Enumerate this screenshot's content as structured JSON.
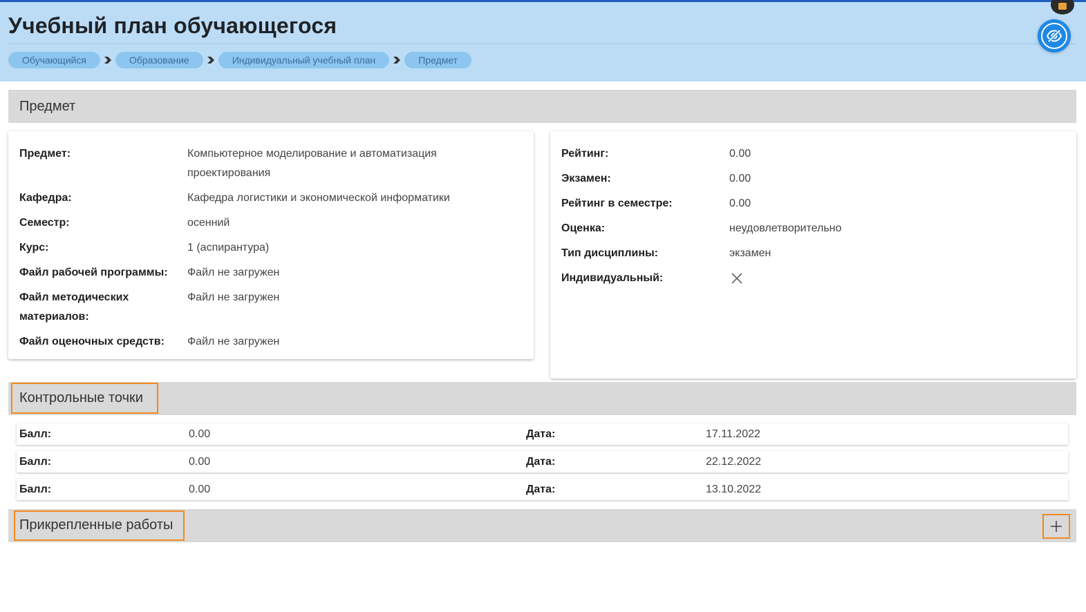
{
  "header": {
    "title": "Учебный план обучающегося",
    "breadcrumbs": [
      "Обучающийся",
      "Образование",
      "Индивидуальный учебный план",
      "Предмет"
    ],
    "hide_icon": "eye-off-icon",
    "chat_icon": "chat-icon"
  },
  "subject_section": {
    "title": "Предмет",
    "left": [
      {
        "label": "Предмет:",
        "value_line1": "Компьютерное моделирование и автоматизация",
        "value_line2": "проектирования"
      },
      {
        "label": "Кафедра:",
        "value": "Кафедра логистики и экономической информатики"
      },
      {
        "label": "Семестр:",
        "value": "осенний"
      },
      {
        "label": "Курс:",
        "value": "1 (аспирантура)"
      },
      {
        "label": "Файл рабочей программы:",
        "value": "Файл не загружен"
      },
      {
        "label_line1": "Файл методических",
        "label_line2": "материалов:",
        "value": "Файл не загружен"
      },
      {
        "label": "Файл оценочных средств:",
        "value": "Файл не загружен"
      }
    ],
    "right": [
      {
        "label": "Рейтинг:",
        "value": "0.00"
      },
      {
        "label": "Экзамен:",
        "value": "0.00"
      },
      {
        "label": "Рейтинг в семестре:",
        "value": "0.00"
      },
      {
        "label": "Оценка:",
        "value": "неудовлетворительно"
      },
      {
        "label": "Тип дисциплины:",
        "value": "экзамен"
      },
      {
        "label": "Индивидуальный:",
        "value_icon": "close-icon"
      }
    ]
  },
  "checkpoints_section": {
    "title": "Контрольные точки",
    "rows": [
      {
        "score_label": "Балл:",
        "score": "0.00",
        "date_label": "Дата:",
        "date": "17.11.2022"
      },
      {
        "score_label": "Балл:",
        "score": "0.00",
        "date_label": "Дата:",
        "date": "22.12.2022"
      },
      {
        "score_label": "Балл:",
        "score": "0.00",
        "date_label": "Дата:",
        "date": "13.10.2022"
      }
    ]
  },
  "works_section": {
    "title": "Прикрепленные работы",
    "add_icon": "plus-icon"
  },
  "colors": {
    "header_bg": "#bcdcf6",
    "crumb_bg": "#8cc6f0",
    "section_bg": "#d9d9d9",
    "highlight": "#f28a1e",
    "accent": "#1e88e5"
  }
}
